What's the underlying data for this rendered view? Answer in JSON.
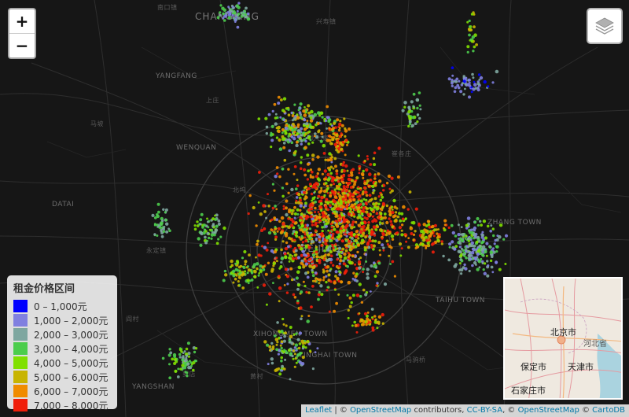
{
  "map": {
    "zoom_in_label": "+",
    "zoom_out_label": "−",
    "layers_icon": "layers-icon",
    "place_labels": [
      "南口镇",
      "CHANGPING",
      "兴寿镇",
      "YANGFANG",
      "上庄",
      "WENQUAN",
      "马坡",
      "北七家",
      "崔各庄",
      "北坞",
      "DATAI",
      "永定镇",
      "BEIJING",
      "TAIHU TOWN",
      "ZHANG TOWN",
      "XIHONGMEN TOWN",
      "YINGHAI TOWN",
      "YANGSHAN",
      "黄村",
      "马驹桥",
      "阎村",
      "窦店"
    ],
    "colors": {
      "background": "#161616",
      "road": "#3a3a3a",
      "ring_road": "#4a4a4a"
    }
  },
  "legend": {
    "title": "租金价格区间",
    "items": [
      {
        "label": "0 – 1,000元",
        "color": "#0000ff"
      },
      {
        "label": "1,000 – 2,000元",
        "color": "#8080e0"
      },
      {
        "label": "2,000 – 3,000元",
        "color": "#7ea7a0"
      },
      {
        "label": "3,000 – 4,000元",
        "color": "#4ccd4c"
      },
      {
        "label": "4,000 – 5,000元",
        "color": "#80e000"
      },
      {
        "label": "5,000 – 6,000元",
        "color": "#c8b400"
      },
      {
        "label": "6,000 – 7,000元",
        "color": "#f08c00"
      },
      {
        "label": "7,000 – 8,000元",
        "color": "#f01e0a"
      }
    ]
  },
  "minimap": {
    "labels": [
      "北京市",
      "河北省",
      "保定市",
      "天津市",
      "石家庄市"
    ]
  },
  "attribution": {
    "leaflet": "Leaflet",
    "sep1": " | © ",
    "osm1": "OpenStreetMap",
    "contributors": " contributors, ",
    "ccbysa": "CC-BY-SA",
    "sep2": ", © ",
    "osm2": "OpenStreetMap",
    "sep3": " © ",
    "carto": "CartoDB"
  }
}
